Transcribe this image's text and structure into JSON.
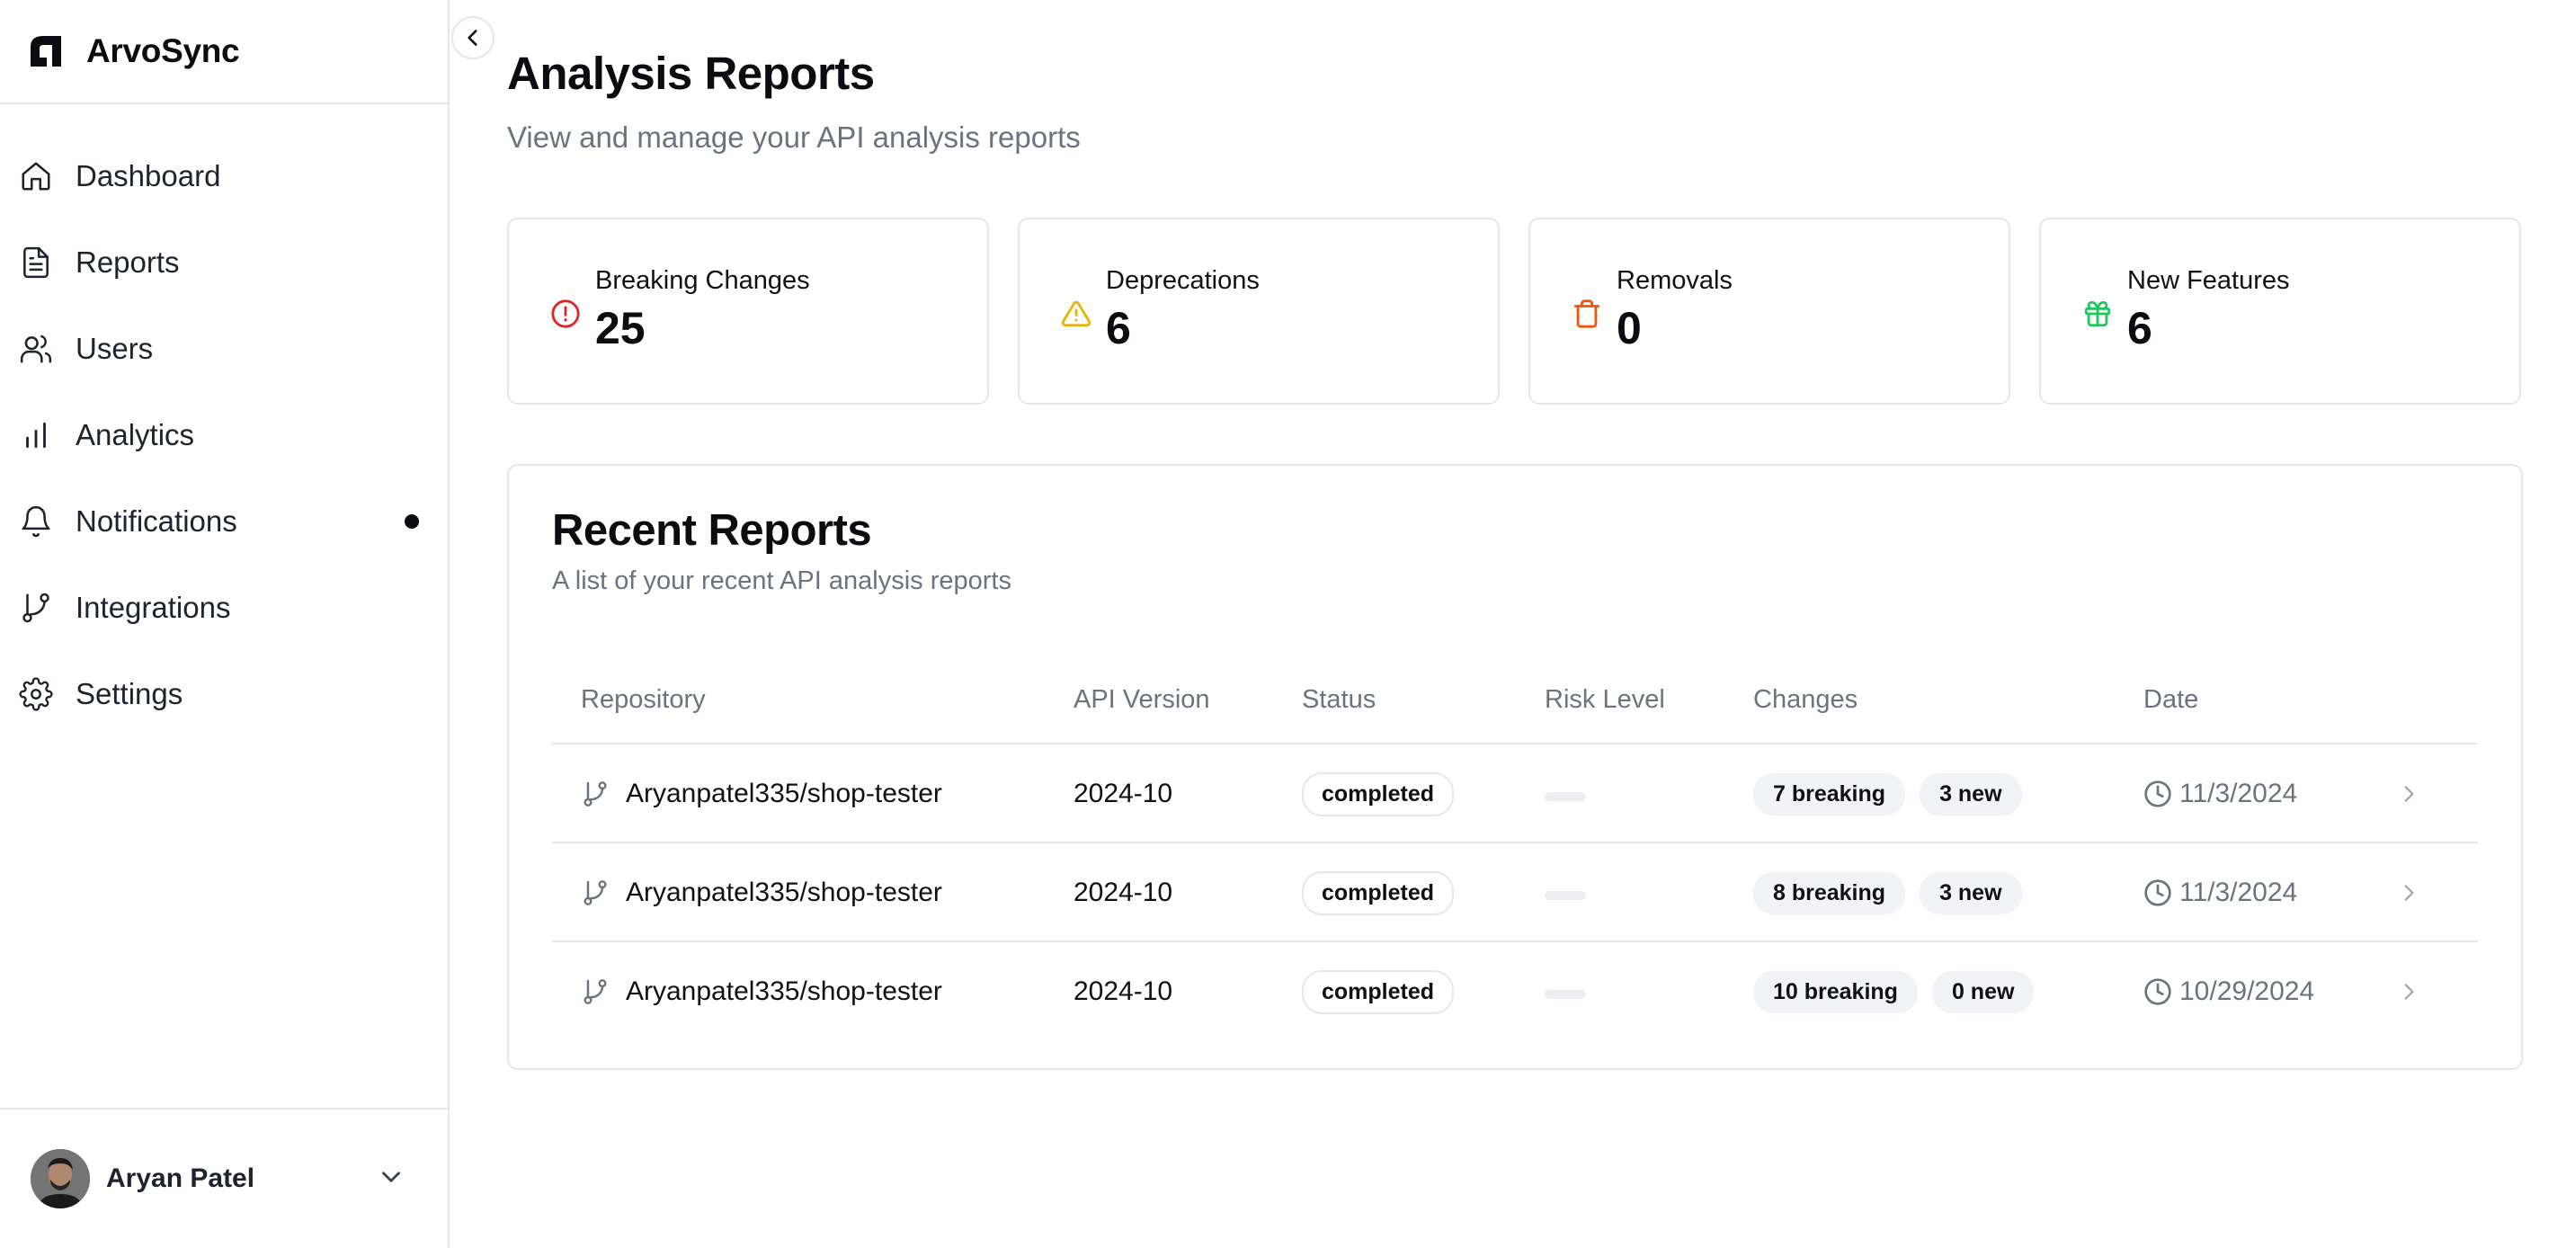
{
  "brand": {
    "name": "ArvoSync"
  },
  "sidebar": {
    "items": [
      {
        "label": "Dashboard",
        "icon": "home-icon"
      },
      {
        "label": "Reports",
        "icon": "file-text-icon"
      },
      {
        "label": "Users",
        "icon": "users-icon"
      },
      {
        "label": "Analytics",
        "icon": "bar-chart-icon"
      },
      {
        "label": "Notifications",
        "icon": "bell-icon",
        "has_dot": true
      },
      {
        "label": "Integrations",
        "icon": "git-branch-icon"
      },
      {
        "label": "Settings",
        "icon": "gear-icon"
      }
    ],
    "user": {
      "name": "Aryan Patel"
    }
  },
  "page": {
    "title": "Analysis Reports",
    "subtitle": "View and manage your API analysis reports"
  },
  "stats": [
    {
      "label": "Breaking Changes",
      "value": "25",
      "icon": "alert-circle-icon",
      "color": "#dc2626"
    },
    {
      "label": "Deprecations",
      "value": "6",
      "icon": "warning-triangle-icon",
      "color": "#eab308"
    },
    {
      "label": "Removals",
      "value": "0",
      "icon": "trash-icon",
      "color": "#ea580c"
    },
    {
      "label": "New Features",
      "value": "6",
      "icon": "gift-icon",
      "color": "#22c55e"
    }
  ],
  "recent": {
    "title": "Recent Reports",
    "subtitle": "A list of your recent API analysis reports",
    "columns": [
      "Repository",
      "API Version",
      "Status",
      "Risk Level",
      "Changes",
      "Date"
    ],
    "rows": [
      {
        "repo": "Aryanpatel335/shop-tester",
        "version": "2024-10",
        "status": "completed",
        "breaking": "7 breaking",
        "new": "3 new",
        "date": "11/3/2024"
      },
      {
        "repo": "Aryanpatel335/shop-tester",
        "version": "2024-10",
        "status": "completed",
        "breaking": "8 breaking",
        "new": "3 new",
        "date": "11/3/2024"
      },
      {
        "repo": "Aryanpatel335/shop-tester",
        "version": "2024-10",
        "status": "completed",
        "breaking": "10 breaking",
        "new": "0 new",
        "date": "10/29/2024"
      }
    ]
  },
  "colors": {
    "accent": "#0b0b12",
    "muted_text": "#6b7280",
    "border": "#e5e7eb",
    "chip_bg": "#f1f3f6"
  }
}
